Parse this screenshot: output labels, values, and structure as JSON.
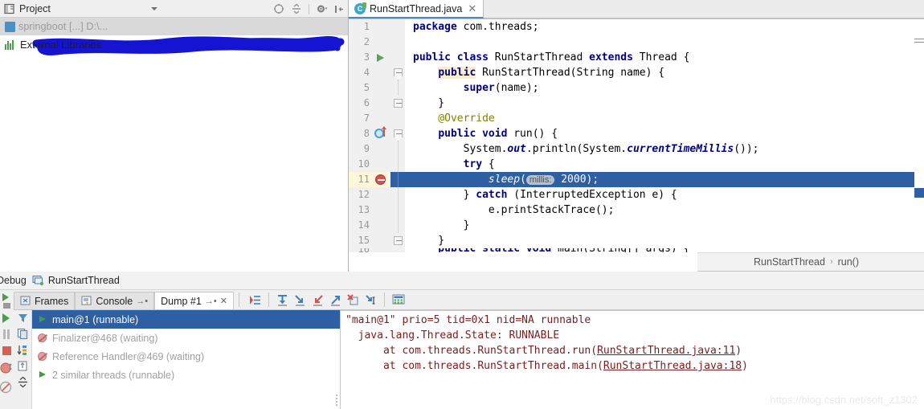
{
  "project_panel": {
    "title": "Project",
    "icon": "project-view-icon",
    "dropdown_icon": "chevron-down-icon",
    "tools": [
      {
        "name": "locate-icon",
        "label": ""
      },
      {
        "name": "collapse-all-icon",
        "label": ""
      },
      {
        "name": "settings-gear-icon",
        "label": ""
      },
      {
        "name": "hide-panel-icon",
        "label": ""
      }
    ],
    "tree": [
      {
        "label": "",
        "redacted": true,
        "icon": "module-icon"
      },
      {
        "label": "External Libraries",
        "redacted": false,
        "icon": "libraries-icon"
      }
    ]
  },
  "editor": {
    "tab": {
      "filename": "RunStartThread.java",
      "icon": "java-class-icon",
      "close_icon": "close-icon"
    },
    "breadcrumb": {
      "class": "RunStartThread",
      "separator": "›",
      "method": "run()"
    },
    "highlighted_line": 11,
    "lines": [
      {
        "num": 1,
        "gutter": "",
        "segments": [
          {
            "t": "package ",
            "c": "kw"
          },
          {
            "t": "com.threads;",
            "c": "plain"
          }
        ]
      },
      {
        "num": 2,
        "gutter": "",
        "segments": []
      },
      {
        "num": 3,
        "gutter": "run-gutter-icon",
        "segments": [
          {
            "t": "public class ",
            "c": "kw"
          },
          {
            "t": "RunStartThread ",
            "c": "plain"
          },
          {
            "t": "extends ",
            "c": "kw"
          },
          {
            "t": "Thread {",
            "c": "plain"
          }
        ]
      },
      {
        "num": 4,
        "gutter": "fold-start-icon",
        "segments": [
          {
            "t": "    ",
            "c": "plain"
          },
          {
            "t": "public",
            "c": "hlkw"
          },
          {
            "t": " RunStartThread(String name) {",
            "c": "plain"
          }
        ]
      },
      {
        "num": 5,
        "gutter": "",
        "segments": [
          {
            "t": "        ",
            "c": "plain"
          },
          {
            "t": "super",
            "c": "kw"
          },
          {
            "t": "(name);",
            "c": "plain"
          }
        ]
      },
      {
        "num": 6,
        "gutter": "fold-end-icon",
        "segments": [
          {
            "t": "    }",
            "c": "plain"
          }
        ]
      },
      {
        "num": 7,
        "gutter": "",
        "segments": [
          {
            "t": "    @Override",
            "c": "anno"
          }
        ]
      },
      {
        "num": 8,
        "gutter": "override-icon",
        "segments": [
          {
            "t": "    ",
            "c": "plain"
          },
          {
            "t": "public void ",
            "c": "kw"
          },
          {
            "t": "run() {",
            "c": "plain"
          }
        ]
      },
      {
        "num": 9,
        "gutter": "",
        "segments": [
          {
            "t": "        System.",
            "c": "plain"
          },
          {
            "t": "out",
            "c": "static-it"
          },
          {
            "t": ".println(System.",
            "c": "plain"
          },
          {
            "t": "currentTimeMillis",
            "c": "static-it"
          },
          {
            "t": "());",
            "c": "plain"
          }
        ]
      },
      {
        "num": 10,
        "gutter": "",
        "segments": [
          {
            "t": "        ",
            "c": "plain"
          },
          {
            "t": "try",
            "c": "kw"
          },
          {
            "t": " {",
            "c": "plain"
          }
        ]
      },
      {
        "num": 11,
        "gutter": "breakpoint-disabled-icon",
        "segments": [
          {
            "t": "            ",
            "c": "plain"
          },
          {
            "t": "sleep",
            "c": "sleep-it"
          },
          {
            "t": "(",
            "c": "plain"
          },
          {
            "t": "millis:",
            "c": "hintchip"
          },
          {
            "t": " 2000);",
            "c": "plain"
          }
        ]
      },
      {
        "num": 12,
        "gutter": "",
        "segments": [
          {
            "t": "        } ",
            "c": "plain"
          },
          {
            "t": "catch ",
            "c": "kw"
          },
          {
            "t": "(InterruptedException e) {",
            "c": "plain"
          }
        ]
      },
      {
        "num": 13,
        "gutter": "",
        "segments": [
          {
            "t": "            e.printStackTrace();",
            "c": "plain"
          }
        ]
      },
      {
        "num": 14,
        "gutter": "",
        "segments": [
          {
            "t": "        }",
            "c": "plain"
          }
        ]
      },
      {
        "num": 15,
        "gutter": "fold-end-icon",
        "segments": [
          {
            "t": "    }",
            "c": "plain"
          }
        ]
      }
    ]
  },
  "debug": {
    "title": "Debug",
    "config_name": "RunStartThread",
    "config_icon": "run-configuration-icon",
    "tabs": [
      {
        "label": "Frames",
        "icon": "frames-icon",
        "active": false,
        "pin": false,
        "close": false
      },
      {
        "label": "Console",
        "icon": "console-icon",
        "active": false,
        "pin": true,
        "close": false
      },
      {
        "label": "Dump #1",
        "icon": "",
        "active": true,
        "pin": true,
        "close": true
      }
    ],
    "toolbar_icons": [
      {
        "name": "export-threads-icon"
      },
      {
        "name": "step-over-icon"
      },
      {
        "name": "step-into-icon"
      },
      {
        "name": "force-step-into-icon"
      },
      {
        "name": "step-out-icon"
      },
      {
        "name": "drop-frame-icon"
      },
      {
        "name": "run-to-cursor-icon"
      },
      {
        "name": "evaluate-expression-icon"
      }
    ],
    "filter_strip_icons": [
      {
        "name": "filter-icon"
      },
      {
        "name": "copy-icon"
      },
      {
        "name": "sort-icon"
      },
      {
        "name": "export-icon"
      },
      {
        "name": "collapse-icon"
      }
    ],
    "left_strip_icons": [
      {
        "name": "resume-program-icon"
      },
      {
        "name": "pause-program-icon"
      },
      {
        "name": "stop-icon"
      },
      {
        "name": "view-breakpoints-icon"
      },
      {
        "name": "mute-breakpoints-icon"
      }
    ],
    "threads": [
      {
        "label": "main@1 (runnable)",
        "state": "runnable",
        "selected": true,
        "icon": "thread-running-icon"
      },
      {
        "label": "Finalizer@468 (waiting)",
        "state": "waiting",
        "selected": false,
        "icon": "thread-waiting-icon"
      },
      {
        "label": "Reference Handler@469 (waiting)",
        "state": "waiting",
        "selected": false,
        "icon": "thread-waiting-icon"
      },
      {
        "label": "2 similar threads (runnable)",
        "state": "runnable",
        "selected": false,
        "icon": "thread-running-icon"
      }
    ],
    "stack_dump": [
      {
        "text": "\"main@1\" prio=5 tid=0x1 nid=NA runnable",
        "link": null
      },
      {
        "text": "  java.lang.Thread.State: RUNNABLE",
        "link": null
      },
      {
        "prefix": "      at com.threads.RunStartThread.run(",
        "link": "RunStartThread.java:11",
        "suffix": ")"
      },
      {
        "prefix": "      at com.threads.RunStartThread.main(",
        "link": "RunStartThread.java:18",
        "suffix": ")"
      }
    ],
    "watermark": "https://blog.csdn.net/soft_z1302"
  },
  "colors": {
    "selection_blue": "#2e5fa3",
    "keyword_navy": "#000080",
    "annotation_olive": "#808000",
    "stack_maroon": "#7a2020",
    "redaction_blue": "#1414d2",
    "tab_underline": "#4a86c8"
  }
}
